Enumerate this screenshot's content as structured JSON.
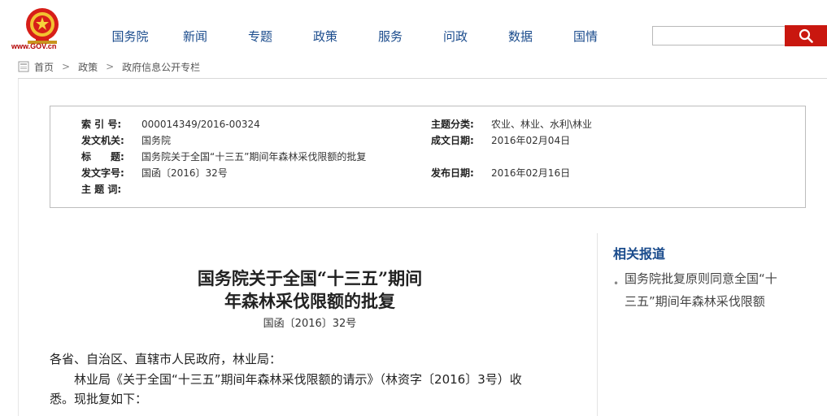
{
  "header": {
    "logo_text": "www.GOV.cn",
    "nav": [
      "国务院",
      "新闻",
      "专题",
      "政策",
      "服务",
      "问政",
      "数据",
      "国情"
    ],
    "search": {
      "placeholder": "",
      "value": ""
    }
  },
  "breadcrumb": [
    "首页",
    "政策",
    "政府信息公开专栏"
  ],
  "meta": {
    "left": [
      {
        "label": "索 引 号:",
        "value": "000014349/2016-00324"
      },
      {
        "label": "发文机关:",
        "value": "国务院"
      },
      {
        "label": "标　　题:",
        "value": "国务院关于全国“十三五”期间年森林采伐限额的批复"
      },
      {
        "label": "发文字号:",
        "value": "国函〔2016〕32号"
      },
      {
        "label": "主 题 词:",
        "value": ""
      }
    ],
    "right": [
      {
        "label": "主题分类:",
        "value": "农业、林业、水利\\林业"
      },
      {
        "label": "成文日期:",
        "value": "2016年02月04日"
      },
      {
        "label": "发布日期:",
        "value": "2016年02月16日"
      }
    ]
  },
  "article": {
    "title_line1": "国务院关于全国“十三五”期间",
    "title_line2": "年森林采伐限额的批复",
    "doc_number": "国函〔2016〕32号",
    "para1": "各省、自治区、直辖市人民政府，林业局：",
    "para2_line1": "　　林业局《关于全国“十三五”期间年森林采伐限额的请示》（林资字〔2016〕3号）收",
    "para2_line2": "悉。现批复如下："
  },
  "related": {
    "title": "相关报道",
    "items": [
      {
        "line1": "国务院批复原则同意全国“十",
        "line2": "三五”期间年森林采伐限额"
      }
    ]
  },
  "colors": {
    "nav_text": "#1a4b8c",
    "search_button": "#c9170f",
    "related_title": "#1a4b8c"
  }
}
